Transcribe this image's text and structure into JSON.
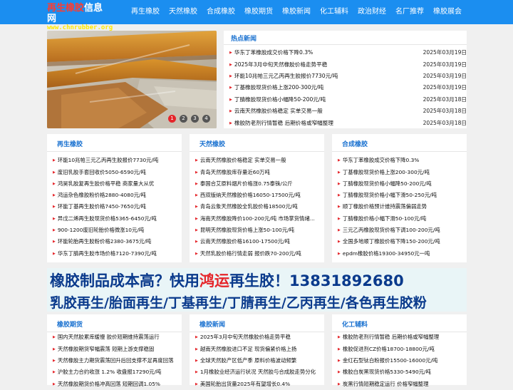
{
  "site": {
    "logo_cn_red": "再生橡胶",
    "logo_cn_white": "信息网",
    "logo_en": "www.chnrubber.org"
  },
  "nav": [
    "再生橡胶",
    "天然橡胶",
    "合成橡胶",
    "橡胶期货",
    "橡胶新闻",
    "化工辅料",
    "政治财经",
    "名厂推荐",
    "橡胶展会"
  ],
  "slider": {
    "pages": [
      "1",
      "2",
      "3",
      "4"
    ],
    "active": "1"
  },
  "hot_news": {
    "title": "热点新闻",
    "items": [
      {
        "title": "华东丁苯橡胶成交价格下降0.3%",
        "date": "2025年03月19日"
      },
      {
        "title": "2025年3月中旬天然橡胶价格走势平稳",
        "date": "2025年03月19日"
      },
      {
        "title": "环能10兆帕三元乙丙再生胶报价7730元/吨",
        "date": "2025年03月19日"
      },
      {
        "title": "丁基橡胶现货价格上涨200-300元/吨",
        "date": "2025年03月19日"
      },
      {
        "title": "丁腈橡胶现货价格小幅降50-200元/吨",
        "date": "2025年03月18日"
      },
      {
        "title": "云南天然橡胶价格稳定 实单交易一般",
        "date": "2025年03月18日"
      },
      {
        "title": "橡胶防老剂行情暂稳 后期价格或窄幅整理",
        "date": "2025年03月18日"
      }
    ]
  },
  "cards_row1": [
    {
      "title": "再生橡胶",
      "items": [
        "环能10兆帕三元乙丙再生胶报价7730元/吨",
        "废旧乳胶手套回收价5050-6590元/吨",
        "鸿昊乳胶复再生胶价格平稳 商家量大从优",
        "鸿运杂色橡胶粉价格2880-4080元/吨",
        "环能丁基再生胶价格7450-7650元/吨",
        "异戊二烯再生胶现货价格5365-6450元/吨",
        "900-1200废旧轮胎价格微涨10元/吨",
        "环能轮胎再生胶粉价格2380-3675元/吨",
        "华东丁腈再生胶市场价格7120-7390元/吨"
      ]
    },
    {
      "title": "天然橡胶",
      "items": [
        "云南天然橡胶价格稳定 实单交易一般",
        "青岛天然橡胶库存量近60万吨",
        "泰国合艾原料烟片价格涨0.75泰铢/公斤",
        "西双版纳天然橡胶价格16050-17500元/吨",
        "青岛云象天然橡胶全乳胶价格18500元/吨",
        "海南天然橡胶降价100-200元/吨 市场掌货情绪...",
        "昆明天然橡胶现货价格上涨50-100元/吨",
        "云南天然橡胶价格16100-17500元/吨",
        "天然乳胶价格行情走弱 报价跌70-200元/吨"
      ]
    },
    {
      "title": "合成橡胶",
      "items": [
        "华东丁苯橡胶成交价格下降0.3%",
        "丁基橡胶现货价格上涨200-300元/吨",
        "丁腈橡胶现货价格小幅降50-200元/吨",
        "丁腈橡胶现货价格小幅下滑50-250元/吨",
        "顺丁橡胶价格预计维持震荡偏弱走势",
        "丁腈橡胶价格小幅下滑50-100元/吨",
        "三元乙丙橡胶现货价格下调100-200元/吨",
        "全国多地顺丁橡胶价格下降150-200元/吨",
        "epdm橡胶价格19300-34950元一吨"
      ]
    }
  ],
  "banner": {
    "line1_a": "橡胶制品成本高？快用",
    "line1_b": "鸿运",
    "line1_c": "再生胶！13831892680",
    "line2": "乳胶再生/胎面再生/丁基再生/丁腈再生/乙丙再生/各色再生胶粉"
  },
  "cards_row2": [
    {
      "title": "橡胶期货",
      "items": [
        "国内天然胶累库缓慢 胶价短期维持震荡运行",
        "天然橡胶期货窄幅震荡 短期上游支撑稳固",
        "天然橡胶主力期货震荡回升后回支撑不足再度回落",
        "沪胶主力合约收涨 1.2% 收盘报17290元/吨",
        "天然橡胶期货价格冲高回落 短期回调1.05%"
      ]
    },
    {
      "title": "橡胶新闻",
      "items": [
        "2025年3月中旬天然橡胶价格走势平稳",
        "越南天然橡胶进口不足 现货偏紧价格上扬",
        "全球天然胶产区低产季 原料价格波动频繁",
        "1月橡胶业经济运行状况 天然胶与合成胶走势分化",
        "美国轮胎出货量2025年有望增长0.4%"
      ]
    },
    {
      "title": "化工辅料",
      "items": [
        "橡胶防老剂行情暂稳 后期价格或窄幅整理",
        "橡胶促进剂CZ价格18700-18800元/吨",
        "金红石型钛白粉报价15500-16000元/吨",
        "橡胶白炭黑现货价格5330-5490元/吨",
        "炭黑行情短期稳定运行 价格窄幅整理"
      ]
    }
  ]
}
